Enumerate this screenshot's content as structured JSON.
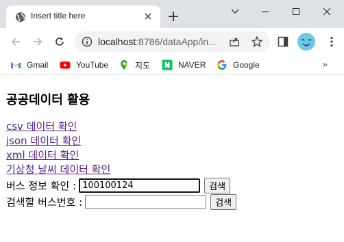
{
  "browser": {
    "tab_title": "Insert title here",
    "url_host": "localhost",
    "url_rest": ":8786/dataApp/in...",
    "bookmarks": [
      {
        "label": "Gmail",
        "icon": "gmail-icon"
      },
      {
        "label": "YouTube",
        "icon": "youtube-icon"
      },
      {
        "label": "지도",
        "icon": "maps-icon"
      },
      {
        "label": "NAVER",
        "icon": "naver-icon"
      },
      {
        "label": "Google",
        "icon": "google-icon"
      }
    ],
    "more_bookmarks": "»"
  },
  "page": {
    "title": "공공데이터 활용",
    "links": [
      "csv 데이터 확인",
      "json 데이터 확인",
      "xml 데이터 확인",
      "기상청 날씨 데이터 확인"
    ],
    "bus_info": {
      "label": "버스 정보 확인 :",
      "value": "100100124",
      "button": "검색"
    },
    "bus_number": {
      "label": "검색할 버스번호 :",
      "value": "",
      "button": "검색"
    }
  },
  "colors": {
    "titlebar": "#dee1e6",
    "visited_link": "#551a8b",
    "omnibox": "#f1f3f4"
  }
}
